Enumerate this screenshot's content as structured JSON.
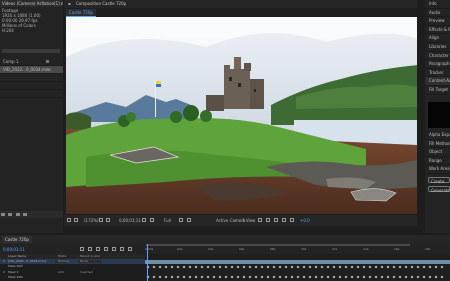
{
  "project": {
    "line1": "Videos (Camera) Asfiation(1).m4v",
    "line2": "Footage ",
    "line3": "1920 x 1080 (1.00)",
    "line4": "0:00:00 29.97 fps",
    "line5": "Millions of Colors",
    "line6": "H.264",
    "search_placeholder": "",
    "items": [
      {
        "label": "Comp 1"
      },
      {
        "label": "VID_2022...0_0034.mov"
      },
      {
        "label": ""
      },
      {
        "label": ""
      },
      {
        "label": ""
      }
    ]
  },
  "comp": {
    "title": "Composition Castle 720p",
    "tab": "Castle 720p",
    "zoom": "(172%)",
    "timecode": "0;00;01;11",
    "resolution": "Full",
    "camera": "Active Camera",
    "views": "1 View",
    "offset": "+0.0"
  },
  "right_panel": {
    "items": [
      "Info",
      "Audio",
      "Preview",
      "Effects & Presets",
      "Align",
      "Libraries",
      "Character",
      "Paragraph",
      "Tracker",
      "Content-Aware Fill"
    ],
    "sub_label": "Fill Target",
    "rows": [
      "Alpha Expansion",
      "Fill Method",
      "Object",
      "Range",
      "Work Area"
    ],
    "btn1": "Create",
    "btn2": "Generate"
  },
  "timeline": {
    "tab": "Castle 720p",
    "timecode": "0;00;01;11",
    "header_name": "Layer Name",
    "header_mode": "Mode",
    "header_parent": "Parent & Link",
    "ruler": [
      "0:00s",
      "02s",
      "04s",
      "06s",
      "08s",
      "10s",
      "12s",
      "14s",
      "16s",
      "18s"
    ],
    "layers": [
      {
        "num": "1",
        "name": "[VID_2022...0_0034.mov]",
        "mode": "Normal",
        "parent": "None"
      },
      {
        "num": "",
        "name": "Mask Path",
        "mode": "",
        "parent": ""
      },
      {
        "num": "2",
        "name": "Mask 2",
        "mode": "Add",
        "parent": "Inverted"
      },
      {
        "num": "",
        "name": "Mask Path",
        "mode": "",
        "parent": ""
      },
      {
        "num": "3",
        "name": "Mask 3",
        "mode": "None",
        "parent": "Inverted"
      }
    ]
  },
  "colors": {
    "accent": "#5da4ff",
    "layer_bar": "#6f8fa8",
    "keyframe": "#c8c8c8"
  }
}
